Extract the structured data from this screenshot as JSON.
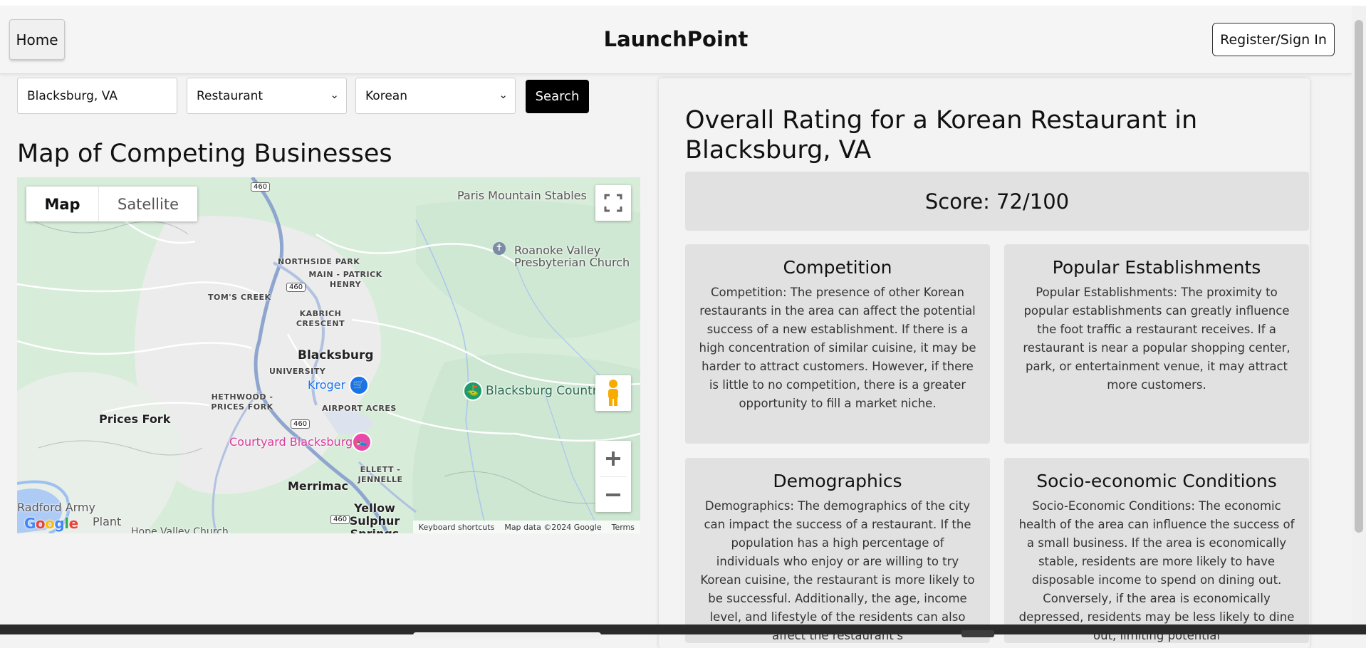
{
  "nav": {
    "home_label": "Home",
    "brand": "LaunchPoint",
    "register_label": "Register/Sign In"
  },
  "search": {
    "location_value": "Blacksburg, VA",
    "business_type": "Restaurant",
    "cuisine": "Korean",
    "button_label": "Search"
  },
  "map_section": {
    "heading": "Map of Competing Businesses",
    "map_tab": "Map",
    "satellite_tab": "Satellite",
    "labels": {
      "paris_mountain": "Paris Mountain Stables",
      "roanoke_valley": "Roanoke Valley Presbyterian Church",
      "northside_park": "NORTHSIDE PARK",
      "main_patrick": "MAIN - PATRICK HENRY",
      "toms_creek": "TOM'S CREEK",
      "kabrich": "KABRICH CRESCENT",
      "blacksburg": "Blacksburg",
      "university": "UNIVERSITY",
      "kroger": "Kroger",
      "hethwood": "HETHWOOD - PRICES FORK",
      "airport_acres": "AIRPORT ACRES",
      "blacksburg_country": "Blacksburg Country",
      "prices_fork": "Prices Fork",
      "courtyard": "Courtyard Blacksburg",
      "ellett": "ELLETT - JENNELLE",
      "merrimac": "Merrimac",
      "radford": "Radford Army",
      "plant": "Plant",
      "yellow_sulphur": "Yellow Sulphur Springs",
      "hope_valley": "Hope Valley Church"
    },
    "route_460": "460",
    "attribution": {
      "shortcuts": "Keyboard shortcuts",
      "map_data": "Map data ©2024 Google",
      "terms": "Terms"
    },
    "logo": "Google"
  },
  "rating": {
    "title": "Overall Rating for a Korean Restaurant in Blacksburg, VA",
    "score_text": "Score: 72/100",
    "cards": [
      {
        "title": "Competition",
        "text": "Competition: The presence of other Korean restaurants in the area can affect the potential success of a new establishment. If there is a high concentration of similar cuisine, it may be harder to attract customers. However, if there is little to no competition, there is a greater opportunity to fill a market niche."
      },
      {
        "title": "Popular Establishments",
        "text": "Popular Establishments: The proximity to popular establishments can greatly influence the foot traffic a restaurant receives. If a restaurant is near a popular shopping center, park, or entertainment venue, it may attract more customers."
      },
      {
        "title": "Demographics",
        "text": "Demographics: The demographics of the city can impact the success of a restaurant. If the population has a high percentage of individuals who enjoy or are willing to try Korean cuisine, the restaurant is more likely to be successful. Additionally, the age, income level, and lifestyle of the residents can also affect the restaurant's"
      },
      {
        "title": "Socio-economic Conditions",
        "text": "Socio-Economic Conditions: The economic health of the area can influence the success of a small business. If the area is economically stable, residents are more likely to have disposable income to spend on dining out. Conversely, if the area is economically depressed, residents may be less likely to dine out, limiting potential"
      }
    ]
  },
  "colors": {
    "map_green": "#d9eedc",
    "road_blue": "#9db3d6",
    "kroger_blue": "#1a73e8",
    "hotel_pink": "#e94aa7",
    "card_bg": "#e1e1e1"
  }
}
